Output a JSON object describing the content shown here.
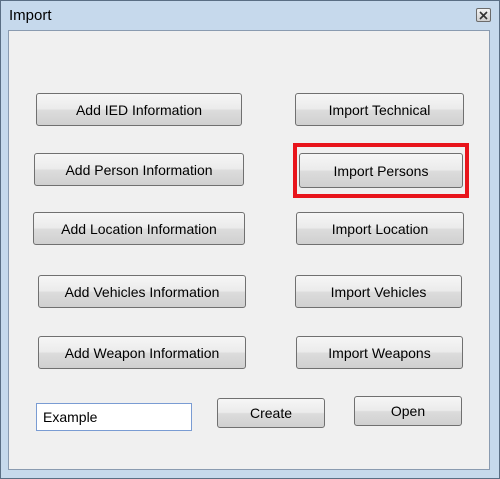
{
  "window": {
    "title": "Import"
  },
  "left_buttons": [
    "Add IED Information",
    "Add Person Information",
    "Add Location Information",
    "Add Vehicles Information",
    "Add Weapon Information"
  ],
  "right_buttons": [
    "Import Technical",
    "Import Persons",
    "Import Location",
    "Import Vehicles",
    "Import Weapons"
  ],
  "input": {
    "value": "Example"
  },
  "actions": {
    "create_label": "Create",
    "open_label": "Open"
  },
  "highlight": {
    "target": "Import Persons",
    "color": "#e8141b"
  }
}
